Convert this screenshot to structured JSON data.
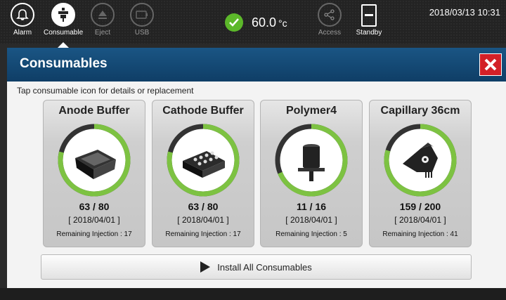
{
  "toolbar": {
    "alarm_label": "Alarm",
    "consumable_label": "Consumable",
    "eject_label": "Eject",
    "usb_label": "USB",
    "access_label": "Access",
    "standby_label": "Standby",
    "temperature": "60.0",
    "temperature_unit": "°c",
    "datetime": "2018/03/13 10:31"
  },
  "panel": {
    "title": "Consumables",
    "instruction": "Tap consumable icon for details or replacement",
    "install_label": "Install All Consumables"
  },
  "cards": [
    {
      "name": "Anode Buffer",
      "used": 63,
      "total": 80,
      "count": "63 / 80",
      "date": "[ 2018/04/01 ]",
      "remaining": "Remaining Injection : 17",
      "icon": "anode-buffer-icon"
    },
    {
      "name": "Cathode Buffer",
      "used": 63,
      "total": 80,
      "count": "63 / 80",
      "date": "[ 2018/04/01 ]",
      "remaining": "Remaining Injection : 17",
      "icon": "cathode-buffer-icon"
    },
    {
      "name": "Polymer4",
      "used": 11,
      "total": 16,
      "count": "11 / 16",
      "date": "[ 2018/04/01 ]",
      "remaining": "Remaining Injection : 5",
      "icon": "polymer-icon"
    },
    {
      "name": "Capillary 36cm",
      "used": 159,
      "total": 200,
      "count": "159 / 200",
      "date": "[ 2018/04/01 ]",
      "remaining": "Remaining Injection : 41",
      "icon": "capillary-icon"
    }
  ],
  "colors": {
    "ring_green": "#7dc242",
    "ring_dark": "#333333",
    "header_blue": "#15507c",
    "close_red": "#d32027",
    "ok_green": "#5cb82a"
  }
}
